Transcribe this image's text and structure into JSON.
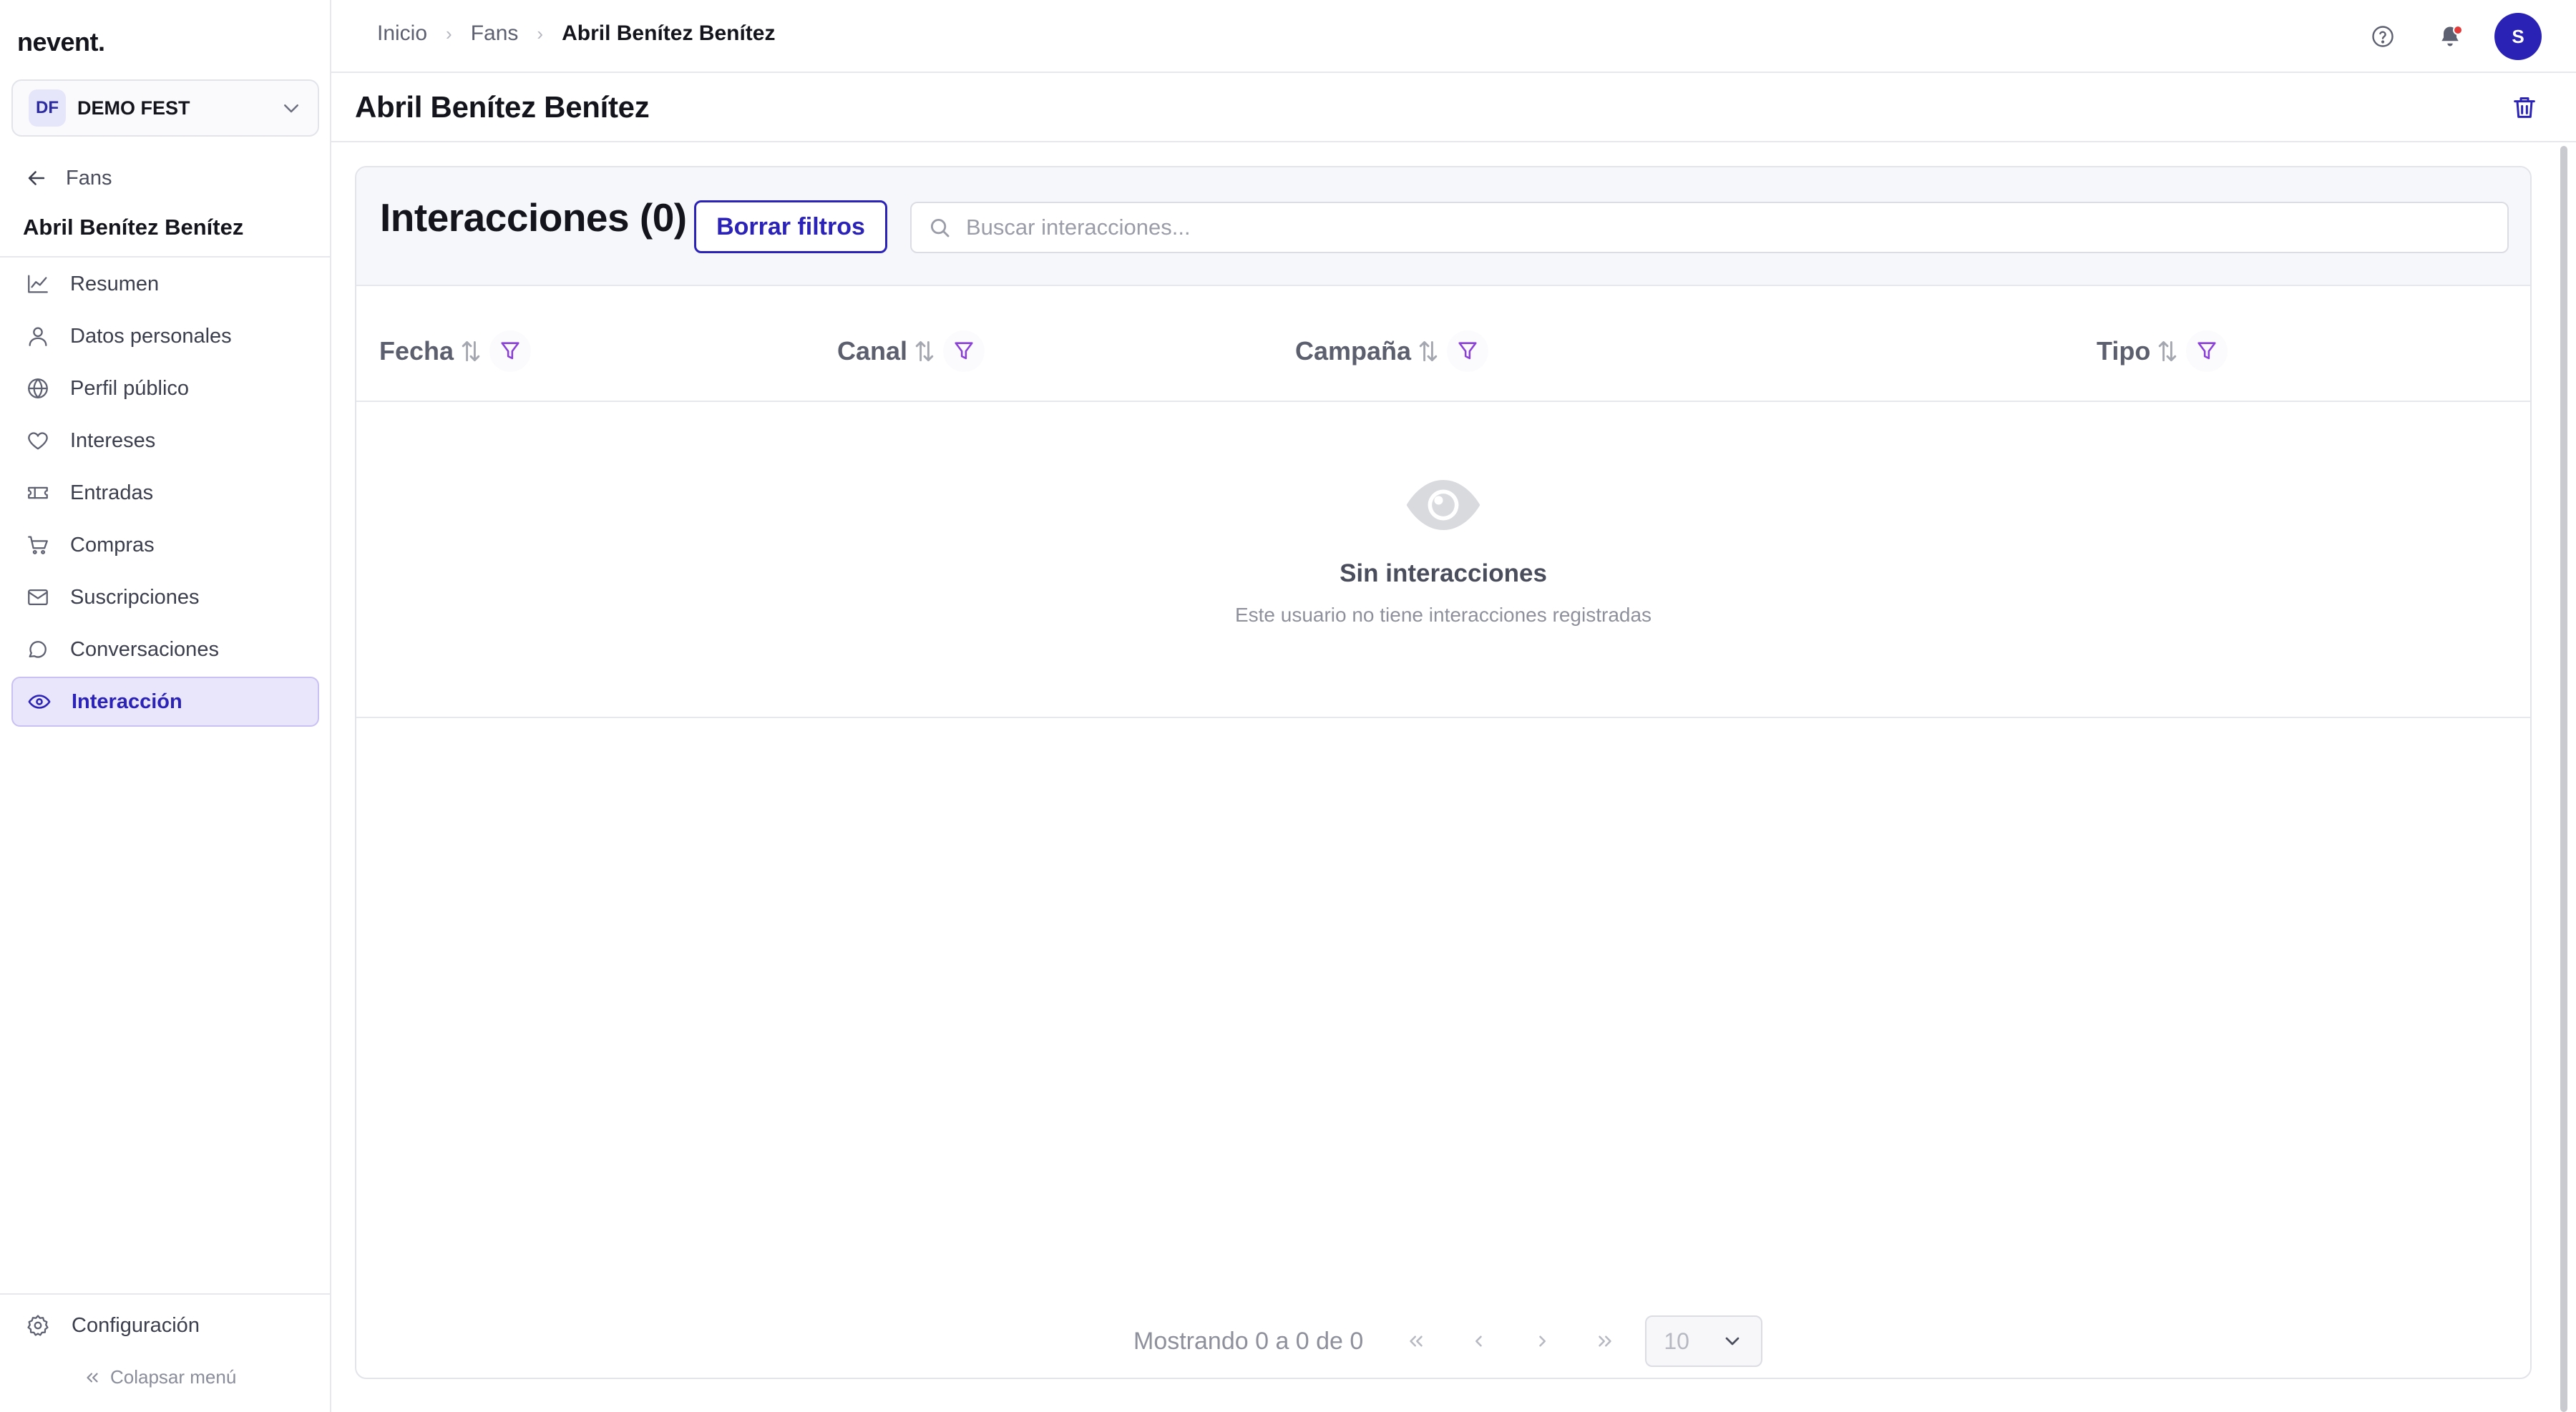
{
  "app": {
    "logo": "nevent.",
    "org": {
      "initials": "DF",
      "name": "DEMO FEST"
    }
  },
  "sidebar": {
    "back_label": "Fans",
    "fan_name": "Abril Benítez Benítez",
    "items": [
      {
        "label": "Resumen",
        "icon": "chart-line-icon"
      },
      {
        "label": "Datos personales",
        "icon": "user-icon"
      },
      {
        "label": "Perfil público",
        "icon": "globe-icon"
      },
      {
        "label": "Intereses",
        "icon": "heart-icon"
      },
      {
        "label": "Entradas",
        "icon": "ticket-icon"
      },
      {
        "label": "Compras",
        "icon": "cart-icon"
      },
      {
        "label": "Suscripciones",
        "icon": "mail-icon"
      },
      {
        "label": "Conversaciones",
        "icon": "chat-icon"
      },
      {
        "label": "Interacción",
        "icon": "eye-icon",
        "active": true
      }
    ],
    "config_label": "Configuración",
    "collapse_label": "Colapsar menú"
  },
  "topbar": {
    "breadcrumbs": [
      "Inicio",
      "Fans",
      "Abril Benítez Benítez"
    ],
    "avatar_initial": "S"
  },
  "page": {
    "title": "Abril Benítez Benítez"
  },
  "interactions": {
    "title": "Interacciones (0)",
    "clear_filters_label": "Borrar filtros",
    "search_placeholder": "Buscar interacciones...",
    "columns": [
      "Fecha",
      "Canal",
      "Campaña",
      "Tipo"
    ],
    "empty_title": "Sin interacciones",
    "empty_subtitle": "Este usuario no tiene interacciones registradas"
  },
  "pagination": {
    "info": "Mostrando 0 a 0 de 0",
    "per_page": "10"
  },
  "colors": {
    "accent": "#2b23b8",
    "accent_soft": "#e9e6fb",
    "filter_icon": "#8b3fd9",
    "notification_dot": "#e23a3a"
  }
}
